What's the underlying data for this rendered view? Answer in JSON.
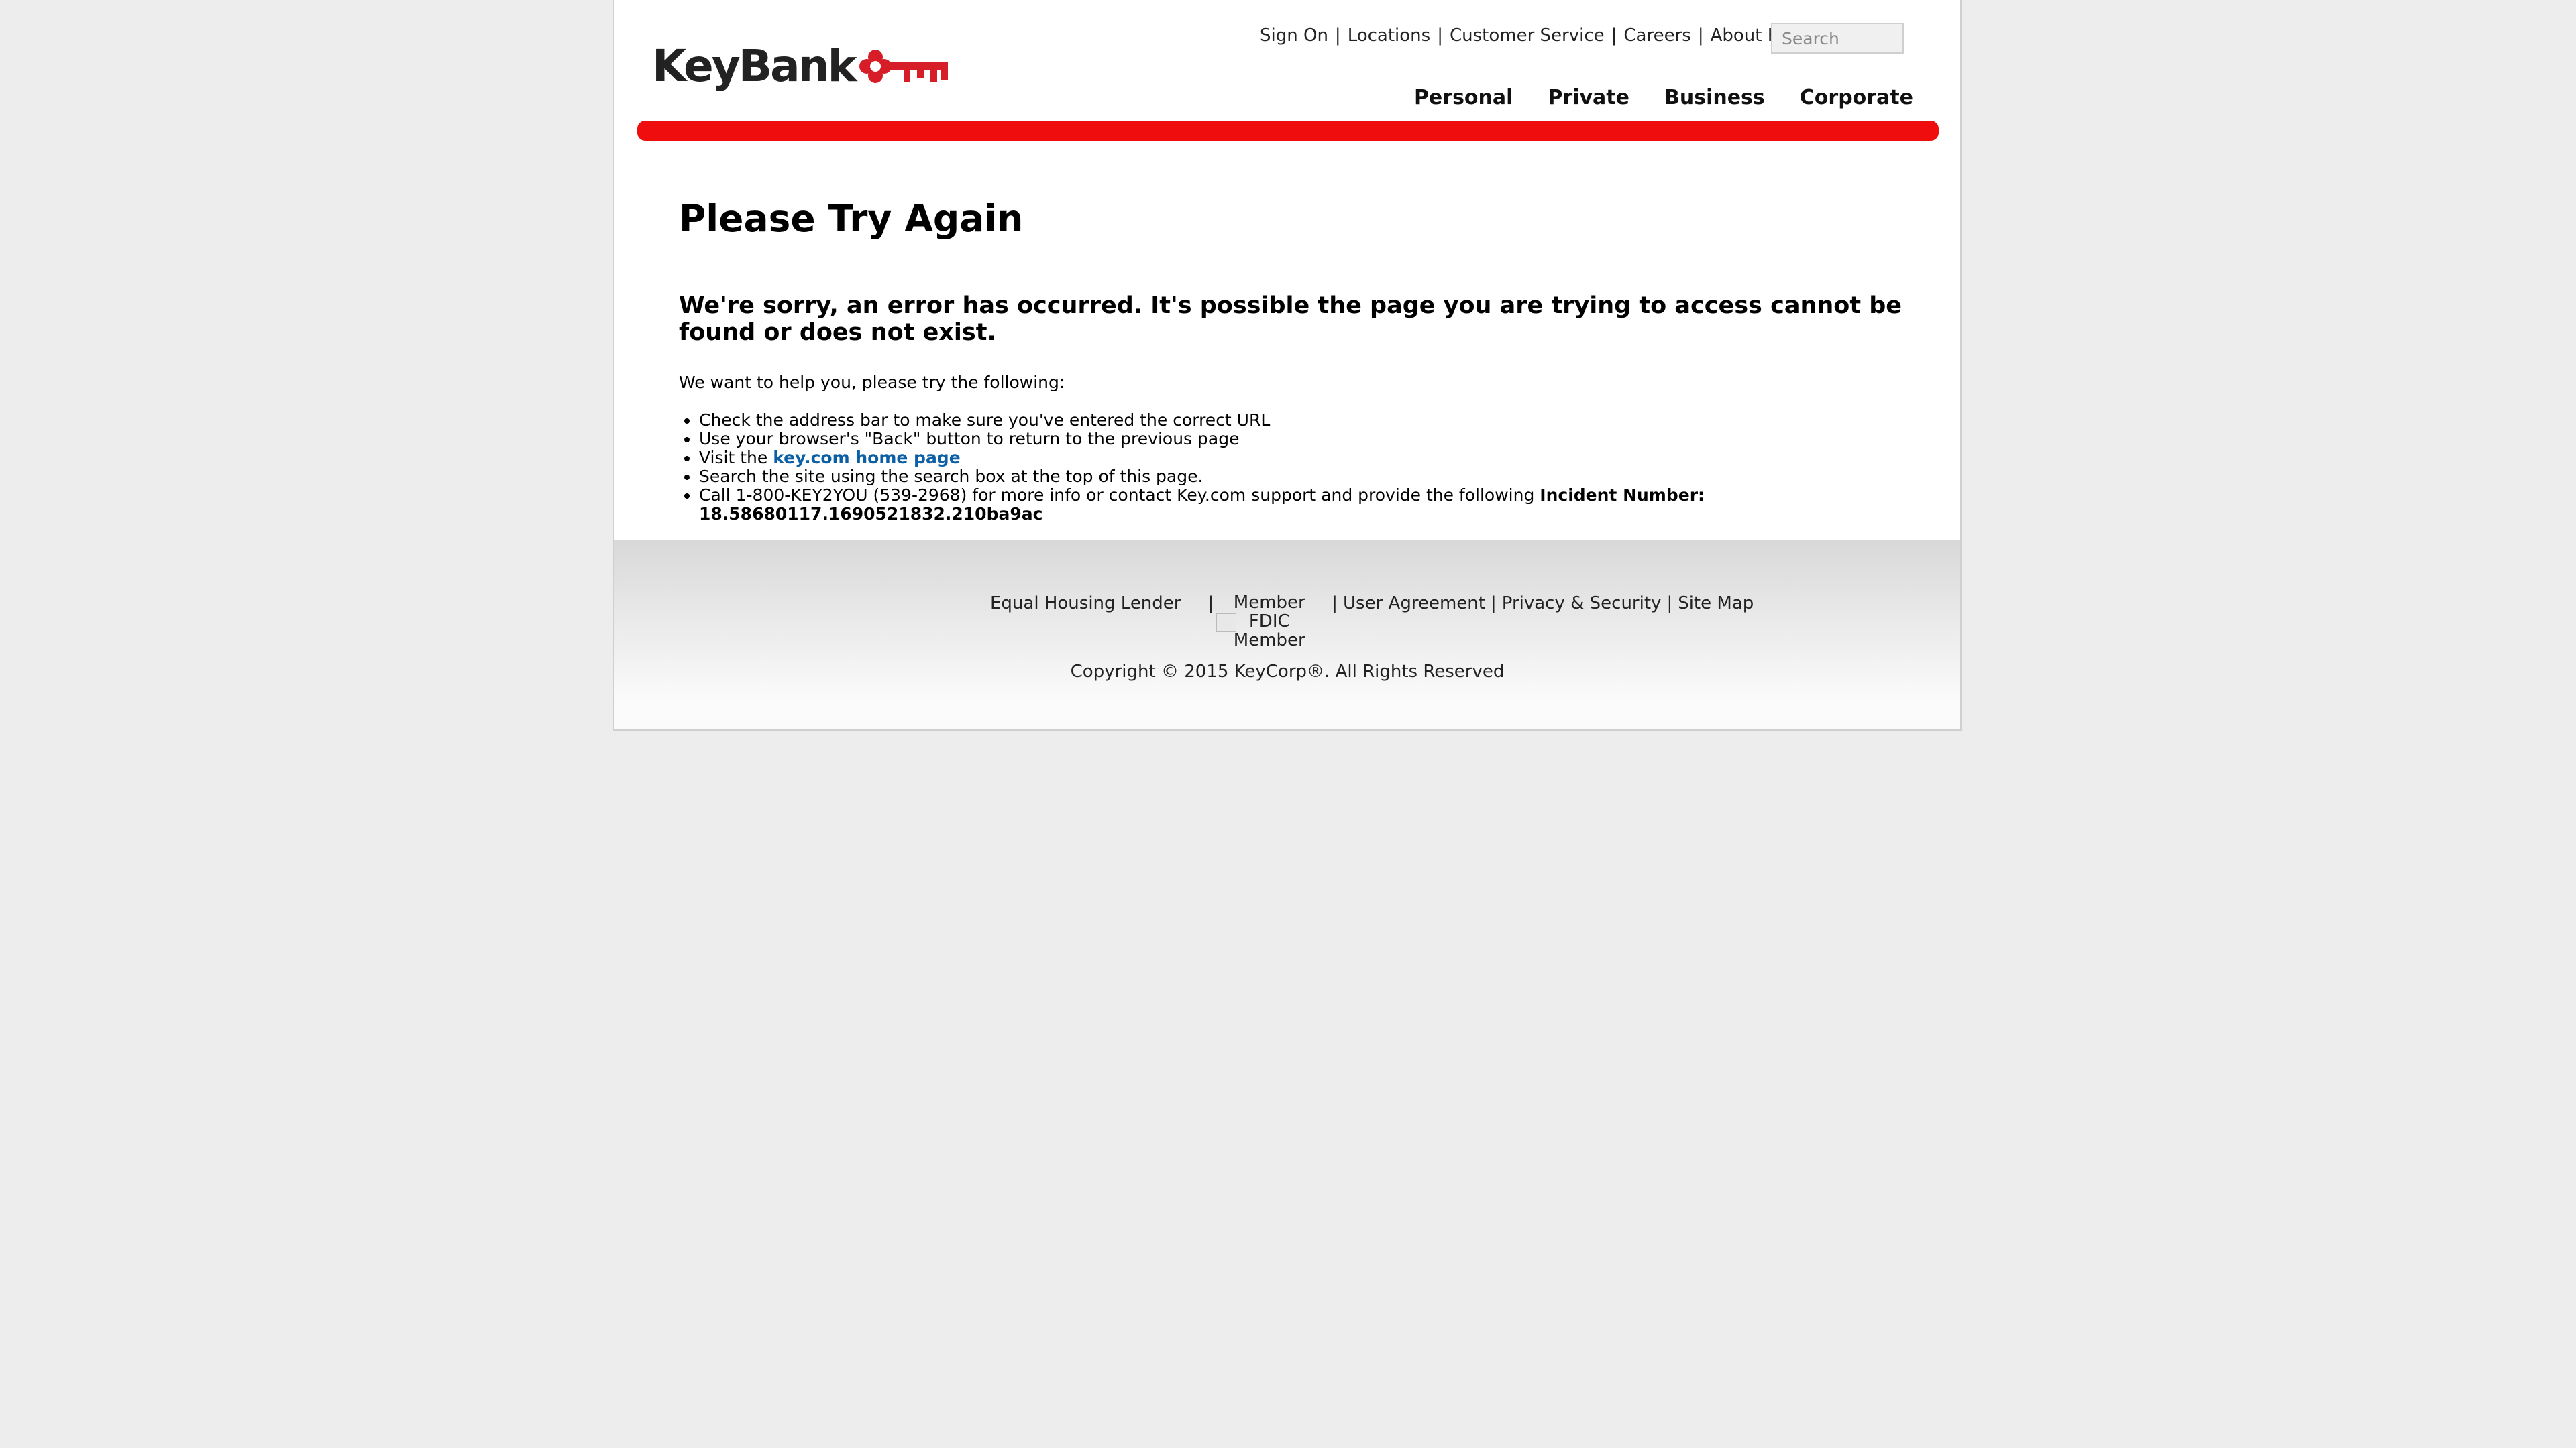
{
  "header": {
    "logo_text": "KeyBank",
    "utility_links": [
      "Sign On",
      "Locations",
      "Customer Service",
      "Careers",
      "About Key"
    ],
    "search_placeholder": "Search",
    "main_nav": [
      "Personal",
      "Private",
      "Business",
      "Corporate"
    ],
    "brand_color": "#ef0d0d"
  },
  "content": {
    "title": "Please Try Again",
    "subtitle": "We're sorry, an error has occurred. It's possible the page you are trying to access cannot be found or does not exist.",
    "intro": "We want to help you, please try the following:",
    "tips": {
      "t1": "Check the address bar to make sure you've entered the correct URL",
      "t2": "Use your browser's \"Back\" button to return to the previous page",
      "t3_prefix": "Visit the ",
      "t3_link": "key.com home page",
      "t4": "Search the site using the search box at the top of this page.",
      "t5_prefix": "Call 1-800-KEY2YOU (539-2968) for more info or contact Key.com support and provide the following ",
      "t5_bold_label": "Incident Number:",
      "t5_incident": "18.58680117.1690521832.210ba9ac"
    },
    "link_color": "#0b5fa5"
  },
  "footer": {
    "equal_housing": "Equal Housing Lender",
    "member": "Member",
    "fdic_alt_line1": "FDIC",
    "fdic_alt_line2": "Member",
    "user_agreement": "User Agreement",
    "privacy": "Privacy & Security",
    "site_map": "Site Map",
    "copyright": "Copyright © 2015 KeyCorp®. All Rights Reserved"
  }
}
